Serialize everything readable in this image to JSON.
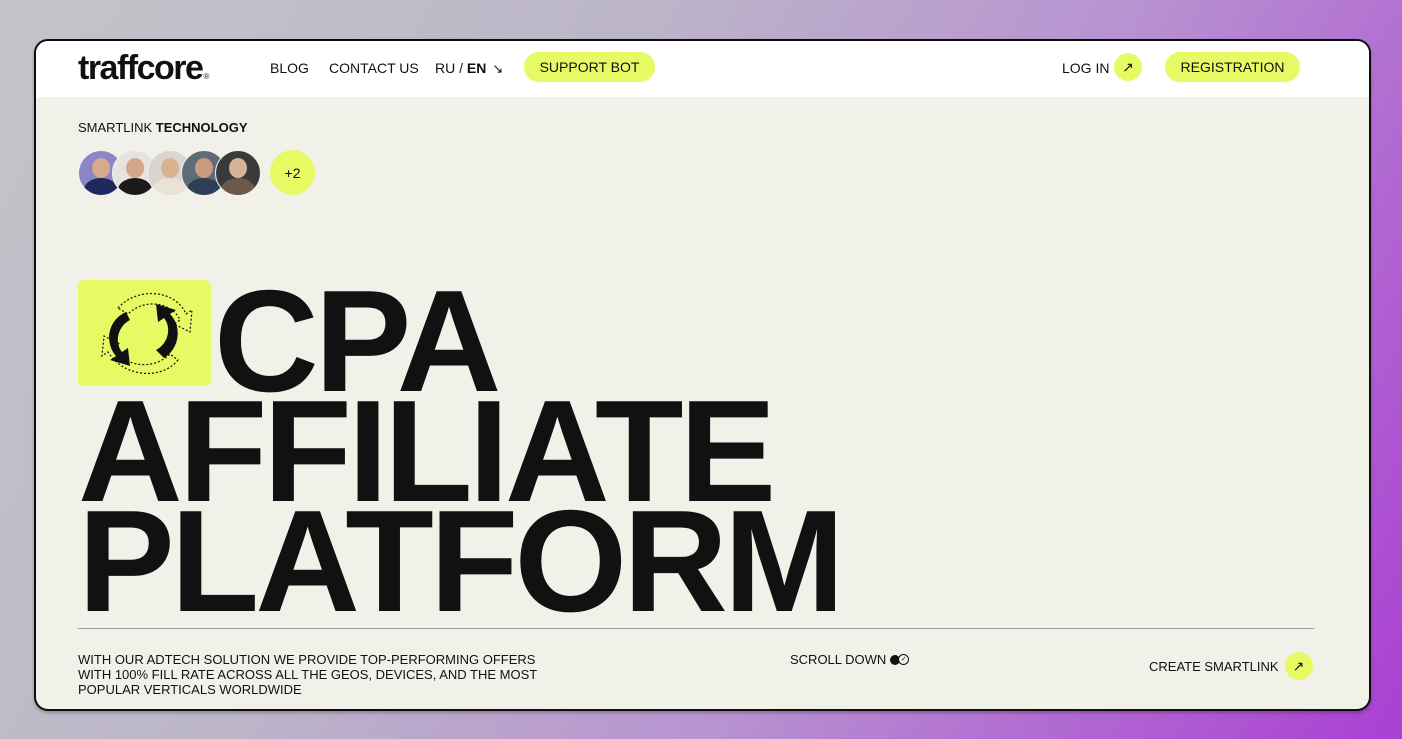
{
  "header": {
    "logo": "traffcore",
    "logo_mark": "®",
    "nav": {
      "blog": "BLOG",
      "contact": "CONTACT US"
    },
    "lang": {
      "ru": "RU",
      "sep": " / ",
      "en": "EN",
      "arrow": "↘"
    },
    "support_bot": "SUPPORT BOT",
    "login": "LOG IN",
    "login_arrow": "↗",
    "registration": "REGISTRATION"
  },
  "hero": {
    "eyebrow_light": "SMARTLINK ",
    "eyebrow_bold": "TECHNOLOGY",
    "avatars_more": "+2",
    "headline_line1": "CPA",
    "headline_line2": "AFFILIATE",
    "headline_line3": "PLATFORM",
    "icon": "rotating-arrows-icon"
  },
  "footer": {
    "description": "WITH OUR ADTECH SOLUTION WE PROVIDE TOP-PERFORMING OFFERS WITH 100% FILL RATE ACROSS ALL THE GEOS, DEVICES, AND THE MOST POPULAR VERTICALS WORLDWIDE",
    "scroll_down": "SCROLL DOWN",
    "scroll_icon": "✓",
    "create_smartlink": "CREATE SMARTLINK",
    "cta_arrow": "↗"
  },
  "colors": {
    "accent": "#e6fb63",
    "page_bg": "#f1f1ea",
    "header_bg": "#ffffff",
    "text": "#111111"
  }
}
